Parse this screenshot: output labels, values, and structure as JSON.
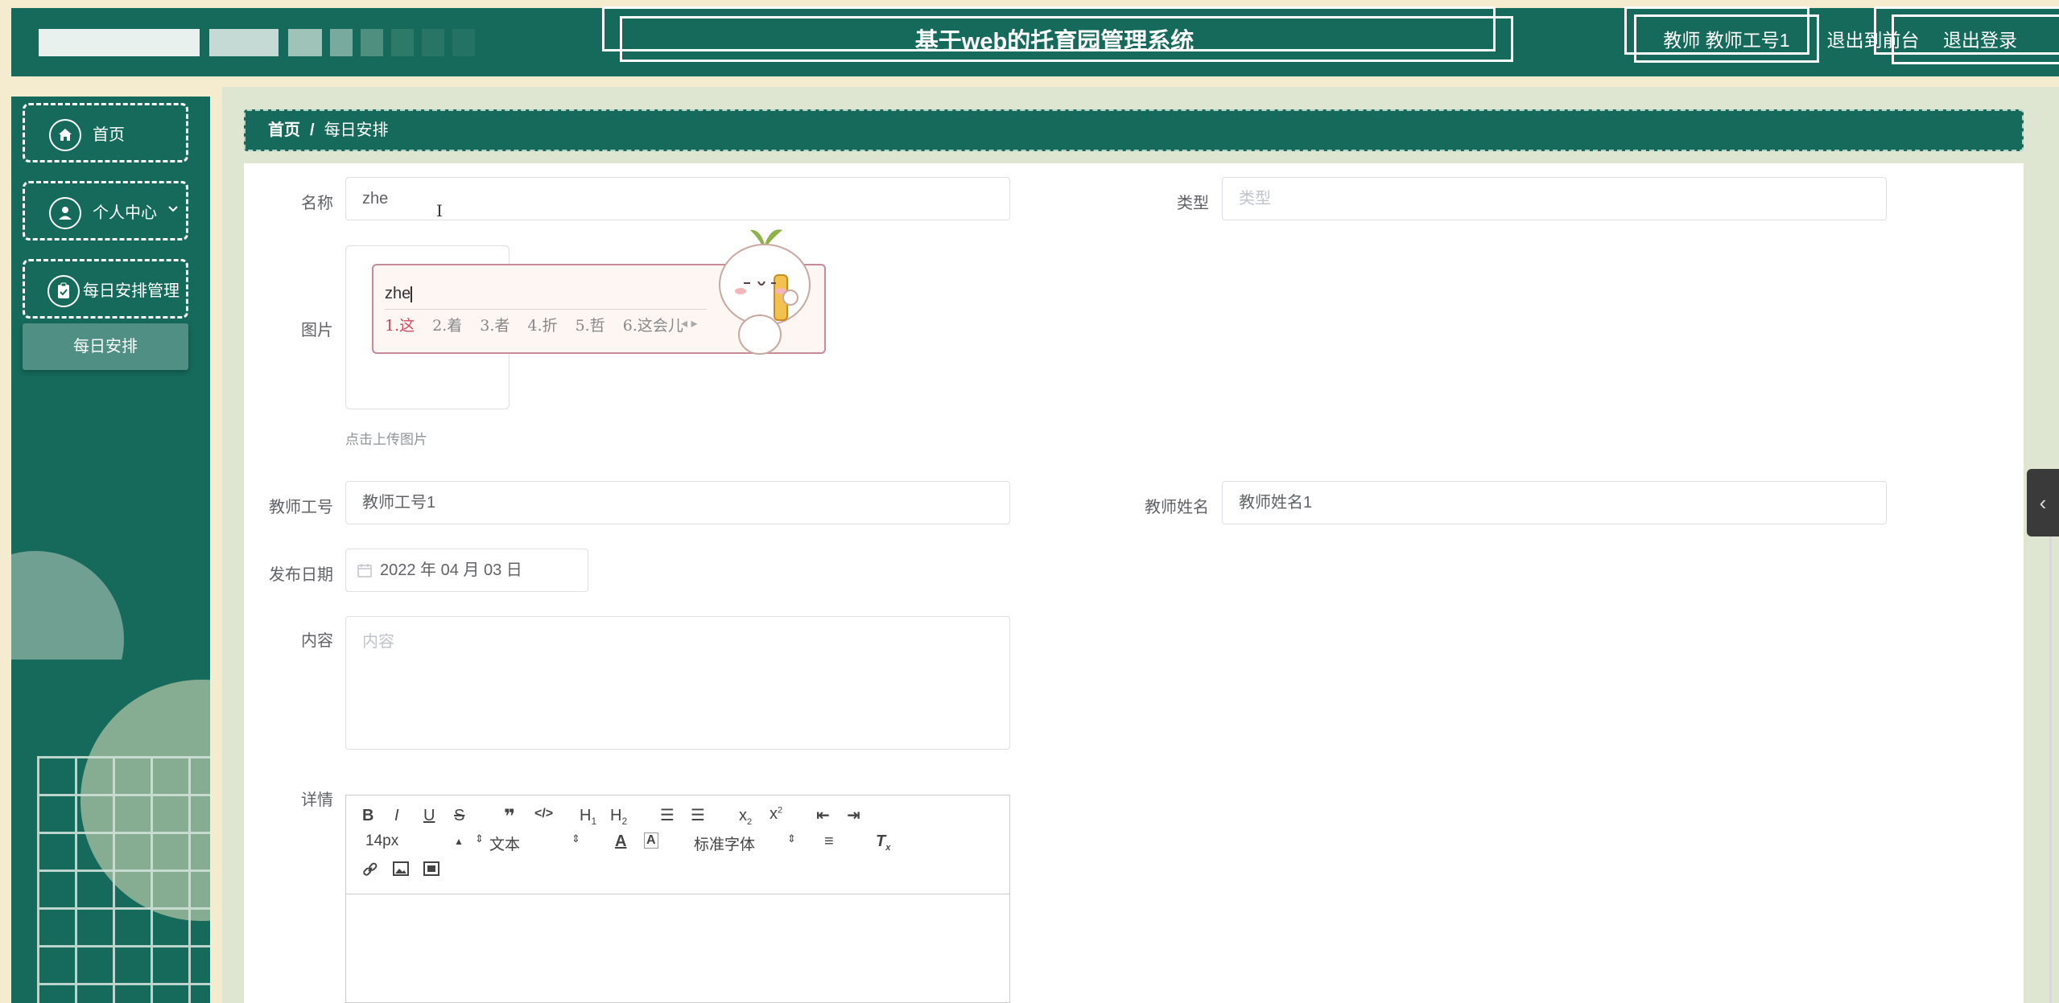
{
  "header": {
    "title": "基于web的托育园管理系统",
    "user_label": "教师 教师工号1",
    "front_link": "退出到前台",
    "logout": "退出登录",
    "color": "#166a5b"
  },
  "sidebar": {
    "items": [
      {
        "label": "首页",
        "icon": "home-icon"
      },
      {
        "label": "个人中心",
        "icon": "user-icon",
        "chevron": "chevron-down-icon"
      },
      {
        "label": "每日安排管理",
        "icon": "clipboard-icon"
      }
    ],
    "submenu": {
      "label": "每日安排"
    }
  },
  "breadcrumb": {
    "home": "首页",
    "separator": "/",
    "current": "每日安排"
  },
  "form": {
    "name": {
      "label": "名称",
      "value": "zhe"
    },
    "type": {
      "label": "类型",
      "placeholder": "类型"
    },
    "image": {
      "label": "图片",
      "hint": "点击上传图片"
    },
    "teacher_id": {
      "label": "教师工号",
      "value": "教师工号1"
    },
    "teacher_name": {
      "label": "教师姓名",
      "value": "教师姓名1"
    },
    "publish_date": {
      "label": "发布日期",
      "value": "2022 年 04 月 03 日"
    },
    "content": {
      "label": "内容",
      "placeholder": "内容"
    },
    "detail": {
      "label": "详情"
    }
  },
  "ime": {
    "input": "zhe",
    "candidates": [
      "1.这",
      "2.着",
      "3.者",
      "4.折",
      "5.哲",
      "6.这会儿"
    ]
  },
  "editor": {
    "font_size": "14px",
    "text_style": "文本",
    "font_family": "标准字体"
  }
}
